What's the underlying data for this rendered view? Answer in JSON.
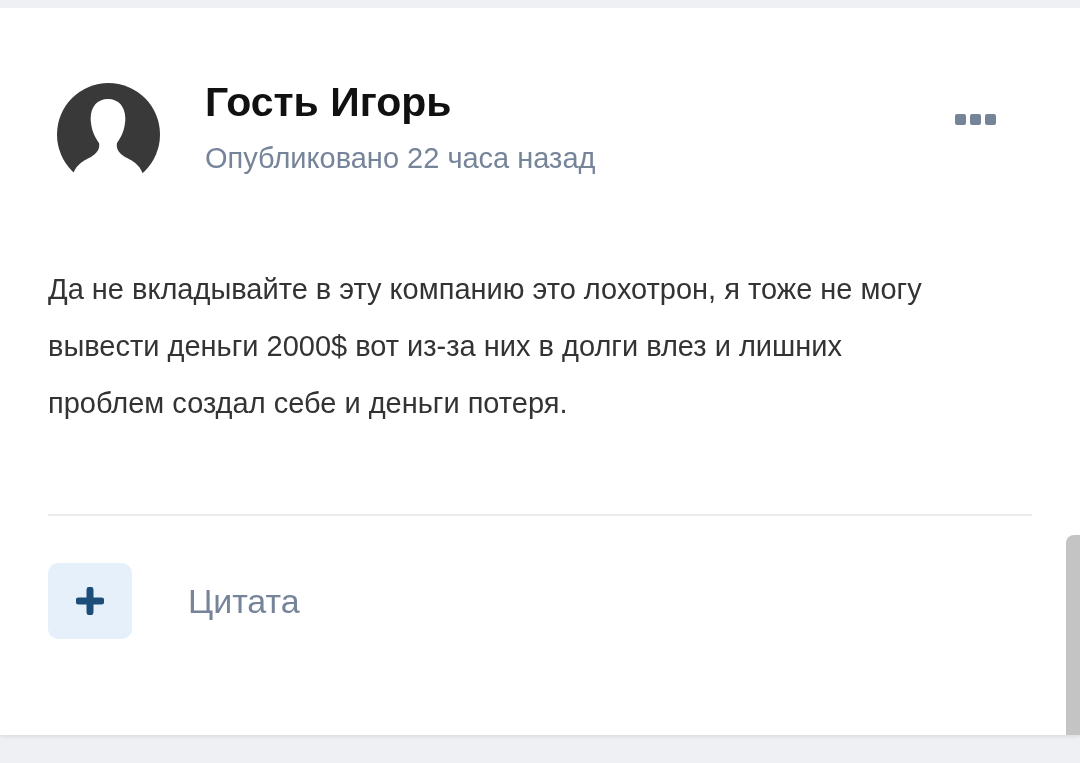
{
  "post": {
    "author": "Гость Игорь",
    "meta": "Опубликовано 22 часа назад",
    "body": "Да не вкладывайте в эту компанию это лохотрон, я тоже не могу вывести деньги 2000$ вот из-за них в долги влез и лишних проблем создал себе и деньги потеря.",
    "actions": [
      {
        "kind": "add",
        "label": "Цитата"
      }
    ]
  }
}
